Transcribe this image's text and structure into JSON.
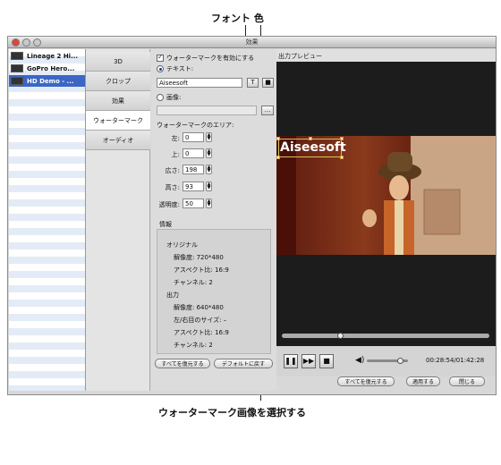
{
  "callouts": {
    "font_color": "フォント 色",
    "select_image": "ウォーターマーク画像を選択する"
  },
  "window": {
    "title": "効果"
  },
  "files": [
    {
      "name": "Lineage 2 Hi..."
    },
    {
      "name": "GoPro Hero..."
    },
    {
      "name": "HD Demo - ..."
    }
  ],
  "tabs": [
    "3D",
    "クロップ",
    "効果",
    "ウォーターマーク",
    "オーディオ"
  ],
  "watermark": {
    "enable_label": "ウォーターマークを有効にする",
    "text_label": "テキスト:",
    "text_value": "Aiseesoft",
    "font_button": "T",
    "color_button": "■",
    "image_label": "画像:",
    "browse_button": "...",
    "area_title": "ウォーターマークのエリア:",
    "fields": [
      {
        "label": "左:",
        "value": "0"
      },
      {
        "label": "上:",
        "value": "0"
      },
      {
        "label": "広さ:",
        "value": "198"
      },
      {
        "label": "高さ:",
        "value": "93"
      },
      {
        "label": "透明度:",
        "value": "50"
      }
    ]
  },
  "info": {
    "title": "情報",
    "original_heading": "オリジナル",
    "original": [
      "解像度: 720*480",
      "アスペクト比: 16:9",
      "チャンネル: 2"
    ],
    "output_heading": "出力",
    "output": [
      "解像度: 640*480",
      "左/右目のサイズ: –",
      "アスペクト比: 16:9",
      "チャンネル: 2"
    ]
  },
  "settings_buttons": {
    "restore_all": "すべてを復元する",
    "restore_default": "デフォルトに戻す"
  },
  "preview": {
    "header": "出力プレビュー",
    "watermark_text": "Aiseesoft",
    "time": "00:28:54/01:42:28",
    "seek_fraction": 0.28,
    "volume_fraction": 0.8
  },
  "footer_buttons": {
    "restore_all": "すべてを復元する",
    "apply": "適用する",
    "close": "閉じる"
  },
  "colors": {
    "selection": "#3b66c4",
    "watermark_frame": "#d8c45a"
  }
}
